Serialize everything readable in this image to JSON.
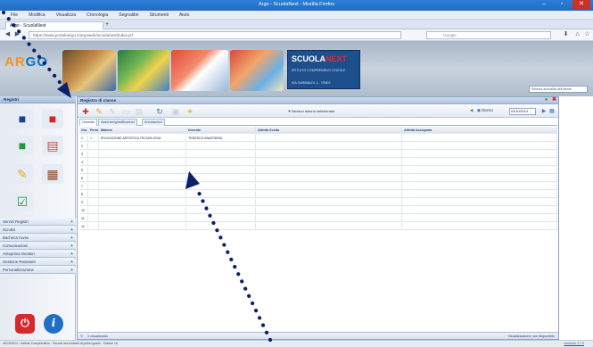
{
  "window": {
    "title": "Argo - ScuolaNext - Mozilla Firefox",
    "minimize": "–",
    "maximize": "▫",
    "close": "✕"
  },
  "menu": [
    "File",
    "Modifica",
    "Visualizza",
    "Cronologia",
    "Segnalibri",
    "Strumenti",
    "Aiuto"
  ],
  "browser": {
    "tab_label": "Argo - ScuolaNext",
    "newtab": "+",
    "url": "https://www.portaleargo.it/argoweb/scuolanext/index.jsf",
    "search_placeholder": "Google",
    "back": "◀",
    "forward": "▶",
    "home": "⌂",
    "download": "⬇",
    "star": "☆"
  },
  "banner": {
    "logo_a": "AR",
    "logo_b": "GO",
    "school_name_a": "SCUOLA",
    "school_name_b": "NEXT",
    "school_line1": "ISTITUTO COMPRENSIVO STATALE",
    "school_line2": "VIA GARIBALDI, 1 - TRIES",
    "search_placeholder": "Ricerca annualità dell'utente"
  },
  "sidebar": {
    "title": "Registri",
    "accordion": [
      "Servizi Registri",
      "Scrutini",
      "Bacheca Avvisi",
      "Comunicazioni",
      "Anteprima Genitori",
      "Gestione Parametri",
      "Personalizzazione"
    ],
    "plus": "+",
    "logout_glyph": "⏻",
    "info_glyph": "i"
  },
  "panel": {
    "title": "Registro di classe",
    "center_label": "Nessun alunno selezionato",
    "date_label": "Giorno",
    "date_value": "03/10/2014",
    "tabs": [
      "Giornale",
      "Assenze/giustificazioni",
      "Annotazioni"
    ],
    "columns": [
      "Ora",
      "Firma",
      "Materia",
      "Docente",
      "Attività Svolta",
      "Attività Assegnata"
    ],
    "rows": [
      {
        "ora": "1",
        "firma": "✔",
        "materia": "EDUCAZIONE ARTISTICA TECNOLOGIA",
        "docente": "TEDESCO ANASTASIA"
      },
      {
        "ora": "2"
      },
      {
        "ora": "3"
      },
      {
        "ora": "4"
      },
      {
        "ora": "5"
      },
      {
        "ora": "6"
      },
      {
        "ora": "7"
      },
      {
        "ora": "8"
      },
      {
        "ora": "9"
      },
      {
        "ora": "10"
      },
      {
        "ora": "11"
      },
      {
        "ora": "12"
      }
    ],
    "footer_left": "1 visualizzato",
    "footer_right": "Visualizzazione non disponibile"
  },
  "statusbar": {
    "left": "2013/2014 - Istituto Comprensivo - Scuola secondaria di primo grado - Classe 1A",
    "right": "versione 3.7.0"
  },
  "colors": {
    "accent": "#2d78c8",
    "arrow": "#0b1f6b"
  }
}
